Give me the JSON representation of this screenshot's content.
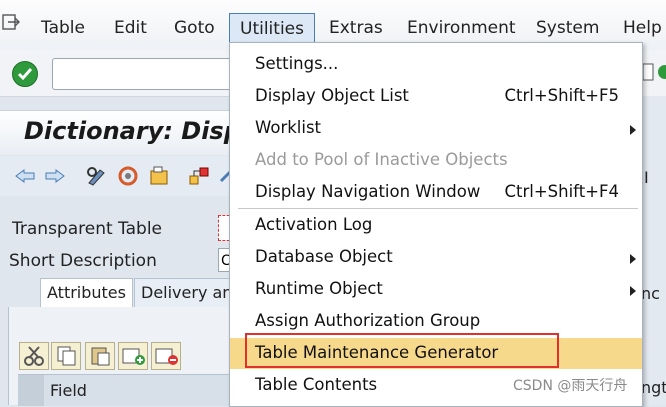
{
  "menubar": {
    "items": [
      "Table",
      "Edit",
      "Goto",
      "Utilities",
      "Extras",
      "Environment",
      "System",
      "Help"
    ]
  },
  "toolbar": {
    "command_value": ""
  },
  "title": {
    "text": "Dictionary: Disp"
  },
  "form": {
    "transparent_table_label": "Transparent Table",
    "short_description_label": "Short Description",
    "table_field_value": "",
    "short_description_value": "C"
  },
  "tabs": [
    "Attributes",
    "Delivery an"
  ],
  "table": {
    "field_header": "Field"
  },
  "right_strip": {
    "r1": "I",
    "r2": "nc",
    "r3": "ngt"
  },
  "dropdown": {
    "items": [
      {
        "label": "Settings...",
        "shortcut": ""
      },
      {
        "label": "Display Object List",
        "shortcut": "Ctrl+Shift+F5"
      },
      {
        "label": "Worklist",
        "shortcut": ""
      },
      {
        "label": "Add to Pool of Inactive Objects",
        "shortcut": ""
      },
      {
        "label": "Display Navigation Window",
        "shortcut": "Ctrl+Shift+F4"
      },
      {
        "label": "Activation Log",
        "shortcut": ""
      },
      {
        "label": "Database Object",
        "shortcut": ""
      },
      {
        "label": "Runtime Object",
        "shortcut": ""
      },
      {
        "label": "Assign Authorization Group",
        "shortcut": ""
      },
      {
        "label": "Table Maintenance Generator",
        "shortcut": ""
      },
      {
        "label": "Table Contents",
        "shortcut": ""
      }
    ]
  },
  "watermark": "CSDN @雨天行舟",
  "colors": {
    "highlight": "#f7d98c",
    "annotation_box": "#e0312b",
    "accent": "#4a7cb5"
  }
}
